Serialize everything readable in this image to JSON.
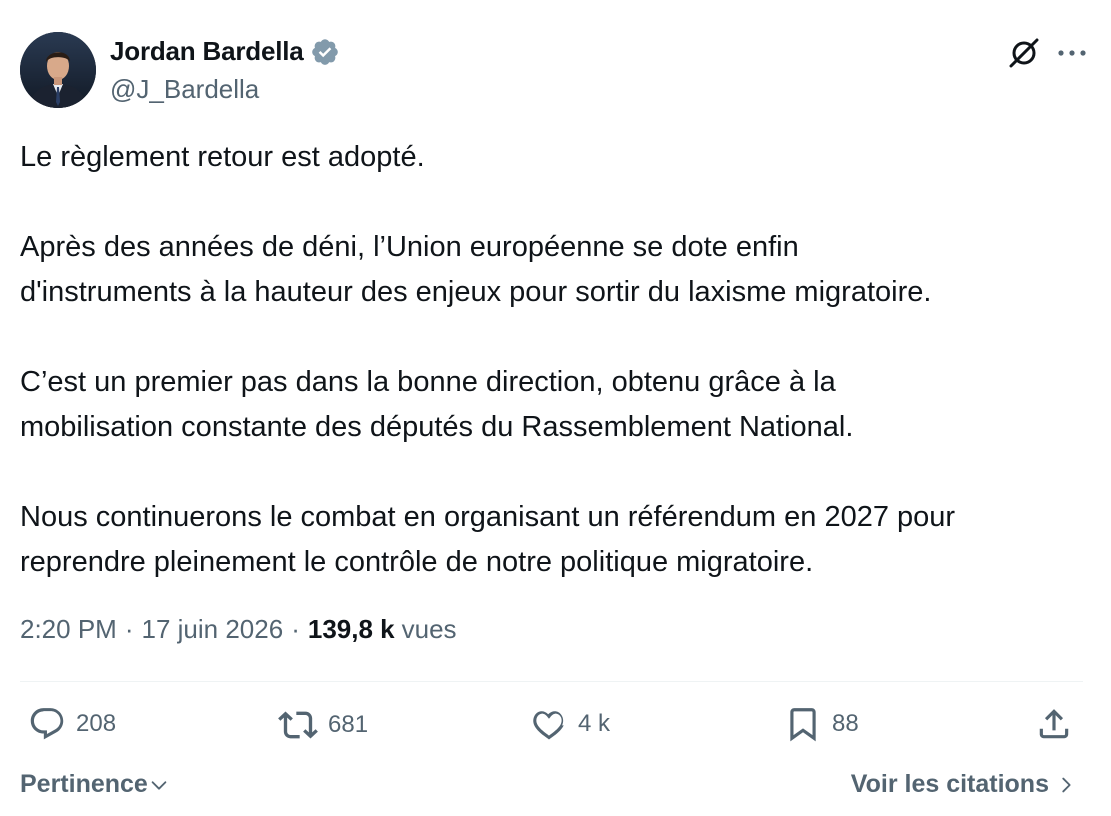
{
  "author": {
    "name": "Jordan Bardella",
    "handle": "@J_Bardella"
  },
  "tweet": {
    "paragraphs": [
      "Le règlement retour est adopté.",
      "Après des années de déni, l’Union européenne se dote enfin\nd'instruments à la hauteur des enjeux pour sortir du laxisme migratoire.",
      "C’est un premier pas dans la bonne direction, obtenu grâce à la\nmobilisation constante des députés du Rassemblement National.",
      "Nous continuerons le combat en organisant un référendum en 2027 pour\nreprendre pleinement le contrôle de notre politique migratoire."
    ]
  },
  "meta": {
    "time": "2:20 PM",
    "separator": "·",
    "date": "17 juin 2026",
    "views_count": "139,8 k",
    "views_label": "vues"
  },
  "actions": {
    "replies": "208",
    "reposts": "681",
    "likes": "4 k",
    "bookmarks": "88"
  },
  "bottom": {
    "sort_label": "Pertinence",
    "quotes_label": "Voir les citations"
  },
  "colors": {
    "text": "#0f1419",
    "secondary": "#536471",
    "verified_badge": "#829aab",
    "divider": "#eff3f4"
  }
}
